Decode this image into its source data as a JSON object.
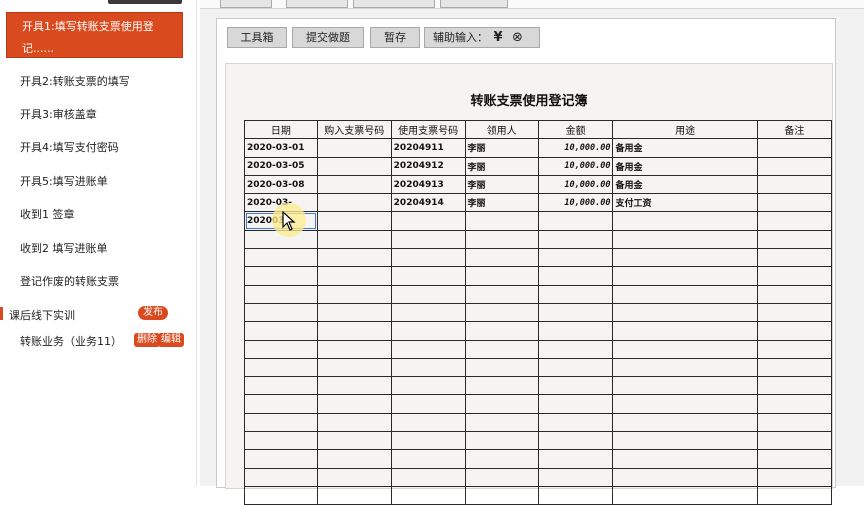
{
  "sidebar": {
    "items": [
      {
        "label": "开具1:填写转账支票使用登记......",
        "active": true
      },
      {
        "label": "开具2:转账支票的填写"
      },
      {
        "label": "开具3:审核盖章"
      },
      {
        "label": "开具4:填写支付密码"
      },
      {
        "label": "开具5:填写进账单"
      },
      {
        "label": "收到1 签章"
      },
      {
        "label": "收到2 填写进账单"
      },
      {
        "label": "登记作废的转账支票"
      }
    ],
    "section": {
      "label": "课后线下实训",
      "badge": "发布"
    },
    "task": {
      "label": "转账业务（业务11）",
      "delete": "删除",
      "edit": "编辑"
    }
  },
  "toolbar": {
    "tools": "工具箱",
    "submit": "提交做题",
    "save": "暂存",
    "assist_label": "辅助输入：",
    "yen_icon": "¥",
    "clear_icon": "⊗"
  },
  "ledger": {
    "title": "转账支票使用登记簿",
    "headers": [
      "日期",
      "购入支票号码",
      "使用支票号码",
      "领用人",
      "金额",
      "用途",
      "备注"
    ],
    "rows": [
      {
        "date": "2020-03-01",
        "buy_no": "",
        "use_no": "20204911",
        "receiver": "李丽",
        "amount": "10,000.00",
        "purpose": "备用金",
        "note": ""
      },
      {
        "date": "2020-03-05",
        "buy_no": "",
        "use_no": "20204912",
        "receiver": "李丽",
        "amount": "10,000.00",
        "purpose": "备用金",
        "note": ""
      },
      {
        "date": "2020-03-08",
        "buy_no": "",
        "use_no": "20204913",
        "receiver": "李丽",
        "amount": "10,000.00",
        "purpose": "备用金",
        "note": ""
      },
      {
        "date": "2020-03-",
        "buy_no": "",
        "use_no": "20204914",
        "receiver": "李丽",
        "amount": "10,000.00",
        "purpose": "支付工资",
        "note": ""
      },
      {
        "date": "2020030",
        "buy_no": "",
        "use_no": "",
        "receiver": "",
        "amount": "",
        "purpose": "",
        "note": ""
      }
    ]
  },
  "colors": {
    "accent": "#d94a1e"
  }
}
